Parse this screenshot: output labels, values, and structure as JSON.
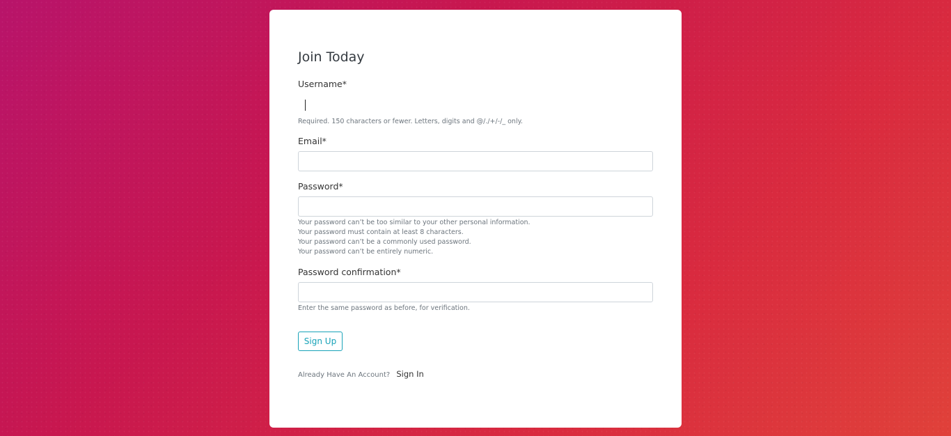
{
  "form": {
    "title": "Join Today",
    "username": {
      "label": "Username*",
      "value": "",
      "help": "Required. 150 characters or fewer. Letters, digits and @/./+/-/_ only."
    },
    "email": {
      "label": "Email*",
      "value": ""
    },
    "password": {
      "label": "Password*",
      "value": "",
      "help": [
        "Your password can’t be too similar to your other personal information.",
        "Your password must contain at least 8 characters.",
        "Your password can’t be a commonly used password.",
        "Your password can’t be entirely numeric."
      ]
    },
    "password_confirm": {
      "label": "Password confirmation*",
      "value": "",
      "help": "Enter the same password as before, for verification."
    },
    "submit_label": "Sign Up",
    "footer": {
      "prompt": "Already Have An Account?",
      "link_label": "Sign In"
    }
  },
  "colors": {
    "background_start": "#b8146a",
    "background_end": "#e0413a",
    "accent": "#17a2b8",
    "card": "#ffffff"
  }
}
